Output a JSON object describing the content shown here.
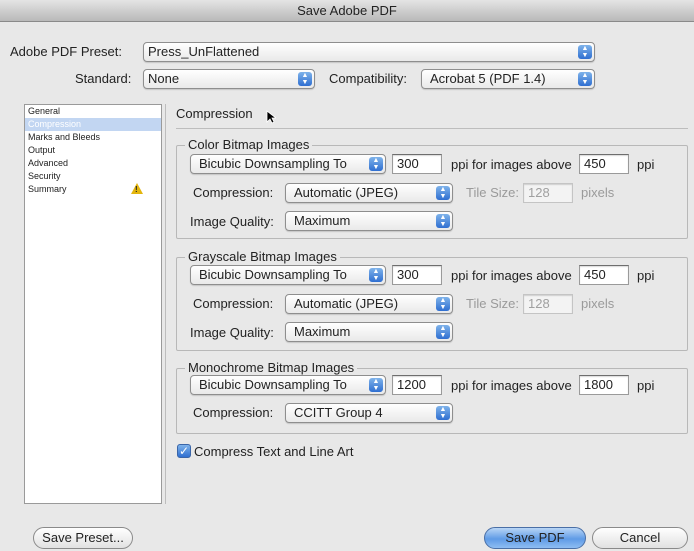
{
  "window": {
    "title": "Save Adobe PDF"
  },
  "preset": {
    "label": "Adobe PDF Preset:",
    "value": "Press_UnFlattened"
  },
  "standard": {
    "label": "Standard:",
    "value": "None"
  },
  "compatibility": {
    "label": "Compatibility:",
    "value": "Acrobat 5 (PDF 1.4)"
  },
  "sidebar": {
    "items": [
      {
        "label": "General"
      },
      {
        "label": "Compression"
      },
      {
        "label": "Marks and Bleeds"
      },
      {
        "label": "Output"
      },
      {
        "label": "Advanced"
      },
      {
        "label": "Security"
      },
      {
        "label": "Summary",
        "icon": "warning-icon"
      }
    ],
    "selected": "Compression"
  },
  "section": {
    "title": "Compression"
  },
  "color": {
    "title": "Color Bitmap Images",
    "sampling": "Bicubic Downsampling To",
    "ppi": "300",
    "above_label": "ppi for images above",
    "above": "450",
    "ppi_unit": "ppi",
    "compression_label": "Compression:",
    "compression": "Automatic (JPEG)",
    "tile_label": "Tile Size:",
    "tile": "128",
    "tile_unit": "pixels",
    "quality_label": "Image Quality:",
    "quality": "Maximum"
  },
  "gray": {
    "title": "Grayscale Bitmap Images",
    "sampling": "Bicubic Downsampling To",
    "ppi": "300",
    "above_label": "ppi for images above",
    "above": "450",
    "ppi_unit": "ppi",
    "compression_label": "Compression:",
    "compression": "Automatic (JPEG)",
    "tile_label": "Tile Size:",
    "tile": "128",
    "tile_unit": "pixels",
    "quality_label": "Image Quality:",
    "quality": "Maximum"
  },
  "mono": {
    "title": "Monochrome Bitmap Images",
    "sampling": "Bicubic Downsampling To",
    "ppi": "1200",
    "above_label": "ppi for images above",
    "above": "1800",
    "ppi_unit": "ppi",
    "compression_label": "Compression:",
    "compression": "CCITT Group 4"
  },
  "compress_text": {
    "label": "Compress Text and Line Art",
    "checked": true
  },
  "buttons": {
    "save_preset": "Save Preset...",
    "save_pdf": "Save PDF",
    "cancel": "Cancel"
  },
  "colors": {
    "accent": "#3b7ee0",
    "selection": "#c2d6f2",
    "warning": "#e3b50c"
  }
}
